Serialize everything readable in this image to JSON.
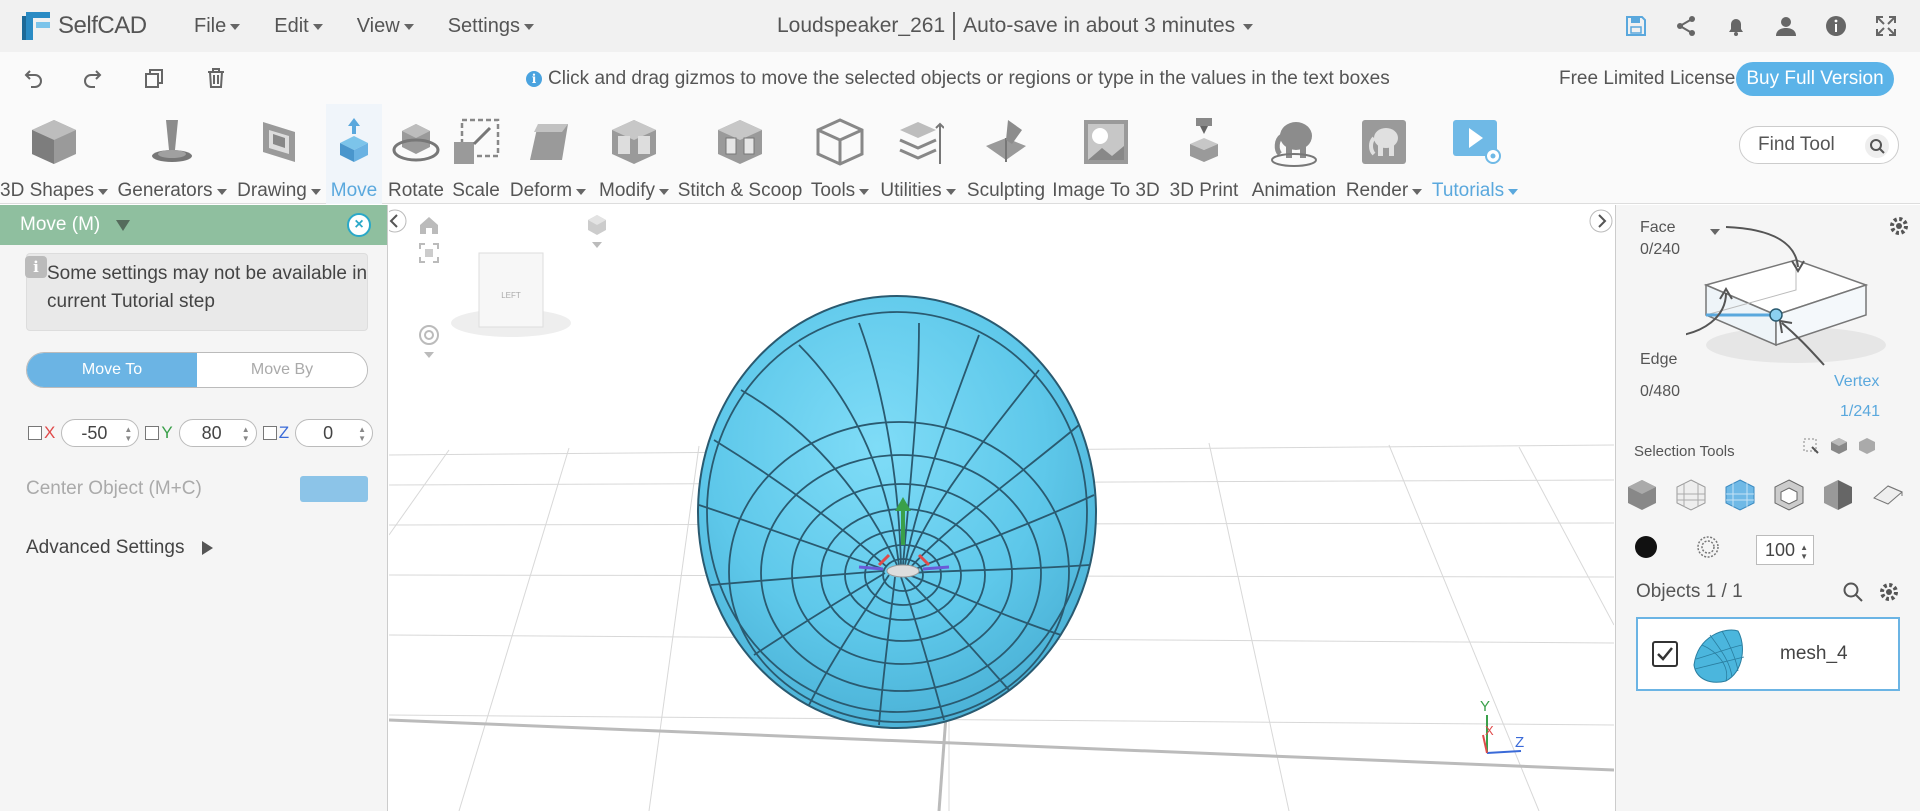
{
  "app": {
    "logo_text": "SelfCAD",
    "menus": [
      "File",
      "Edit",
      "View",
      "Settings"
    ],
    "project_name": "Loudspeaker_261",
    "autosave": "Auto-save in about 3 minutes"
  },
  "actionbar": {
    "hint": "Click and drag gizmos to move the selected objects or regions or type in the values in the text boxes",
    "license": "Free Limited License",
    "buy_label": "Buy Full Version"
  },
  "toolbar": {
    "tools": [
      {
        "label": "3D Shapes",
        "dropdown": true
      },
      {
        "label": "Generators",
        "dropdown": true
      },
      {
        "label": "Drawing",
        "dropdown": true
      },
      {
        "label": "Move",
        "dropdown": false
      },
      {
        "label": "Rotate",
        "dropdown": false
      },
      {
        "label": "Scale",
        "dropdown": false
      },
      {
        "label": "Deform",
        "dropdown": true
      },
      {
        "label": "Modify",
        "dropdown": true
      },
      {
        "label": "Stitch & Scoop",
        "dropdown": false
      },
      {
        "label": "Tools",
        "dropdown": true
      },
      {
        "label": "Utilities",
        "dropdown": true
      },
      {
        "label": "Sculpting",
        "dropdown": false
      },
      {
        "label": "Image To 3D",
        "dropdown": false
      },
      {
        "label": "3D Print",
        "dropdown": false
      },
      {
        "label": "Animation",
        "dropdown": false
      },
      {
        "label": "Render",
        "dropdown": true
      },
      {
        "label": "Tutorials",
        "dropdown": true
      }
    ],
    "find_placeholder": "Find Tool"
  },
  "move_panel": {
    "title": "Move (M)",
    "note": "Some settings may not be available in current Tutorial step",
    "mode_to": "Move To",
    "mode_by": "Move By",
    "x_label": "X",
    "x_value": "-50",
    "y_label": "Y",
    "y_value": "80",
    "z_label": "Z",
    "z_value": "0",
    "center_label": "Center Object (M+C)",
    "advanced_label": "Advanced Settings"
  },
  "viewport": {
    "cube_label": "LEFT",
    "axis_y": "Y",
    "axis_x": "X",
    "axis_z": "Z"
  },
  "right_panel": {
    "face_label": "Face",
    "face_count": "0/240",
    "edge_label": "Edge",
    "edge_count": "0/480",
    "vertex_label": "Vertex",
    "vertex_count": "1/241",
    "selection_tools": "Selection Tools",
    "brush_size": "100",
    "objects_header": "Objects 1 / 1",
    "object_name": "mesh_4"
  },
  "colors": {
    "accent": "#5aa8dd",
    "panel_header": "#8fbf9f",
    "mesh": "#6fd0ef"
  }
}
